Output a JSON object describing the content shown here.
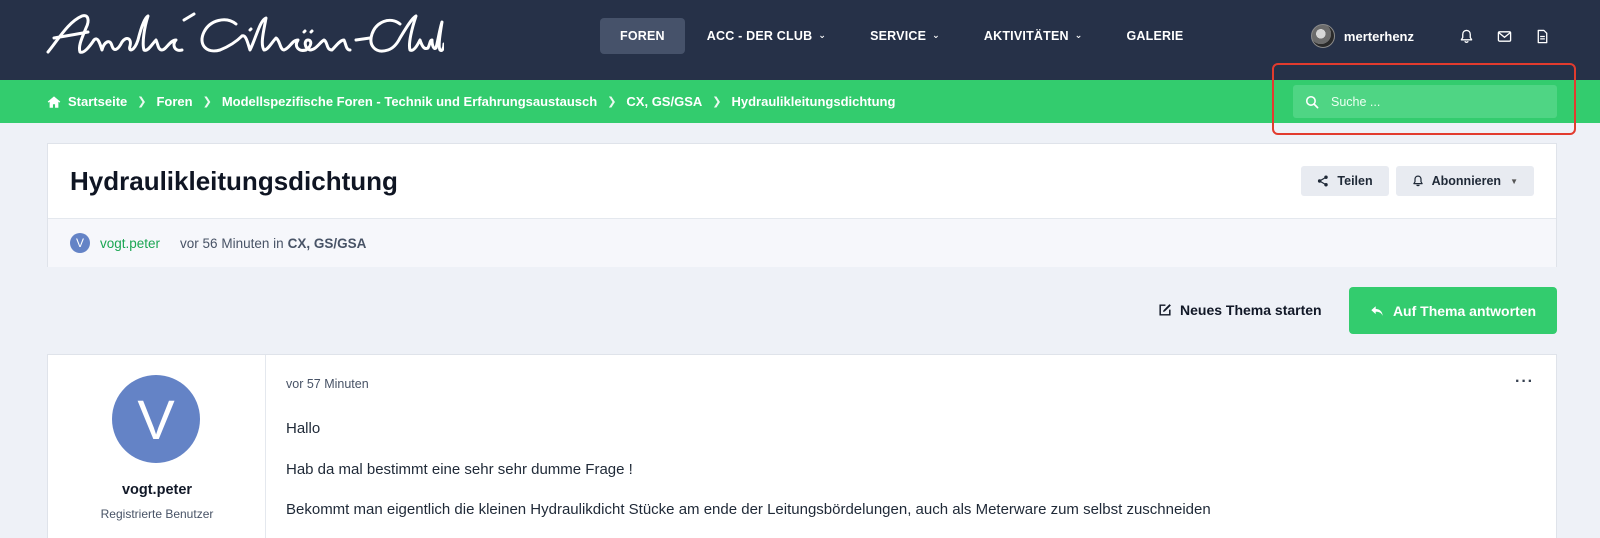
{
  "header": {
    "logo_text": "André Citroën-Club",
    "nav": [
      {
        "label": "FOREN",
        "active": true,
        "dropdown": false
      },
      {
        "label": "ACC - DER CLUB",
        "active": false,
        "dropdown": true
      },
      {
        "label": "SERVICE",
        "active": false,
        "dropdown": true
      },
      {
        "label": "AKTIVITÄTEN",
        "active": false,
        "dropdown": true
      },
      {
        "label": "GALERIE",
        "active": false,
        "dropdown": false
      }
    ],
    "username": "merterhenz",
    "icons": [
      "bell-icon",
      "envelope-icon",
      "document-icon"
    ]
  },
  "breadcrumb": {
    "items": [
      "Startseite",
      "Foren",
      "Modellspezifische Foren - Technik und Erfahrungsaustausch",
      "CX, GS/GSA",
      "Hydraulikleitungsdichtung"
    ]
  },
  "search": {
    "placeholder": "Suche ..."
  },
  "topic": {
    "title": "Hydraulikleitungsdichtung",
    "share_label": "Teilen",
    "follow_label": "Abonnieren",
    "author_initial": "V",
    "author": "vogt.peter",
    "time": "vor 56 Minuten in",
    "forum": "CX, GS/GSA"
  },
  "actions": {
    "new_topic_label": "Neues Thema starten",
    "reply_label": "Auf Thema antworten"
  },
  "post": {
    "avatar_initial": "V",
    "author": "vogt.peter",
    "role": "Registrierte Benutzer",
    "time": "vor 57 Minuten",
    "menu": "···",
    "paragraphs": [
      "Hallo",
      "Hab da mal bestimmt eine sehr sehr dumme Frage !",
      "Bekommt man eigentlich die kleinen Hydraulikdicht Stücke am ende der Leitungsbördelungen, auch als Meterware zum selbst zuschneiden"
    ]
  },
  "colors": {
    "header_bg": "#263148",
    "accent_green": "#33cc6e",
    "avatar_blue": "#6483c6",
    "highlight_red": "#e23b2e"
  }
}
